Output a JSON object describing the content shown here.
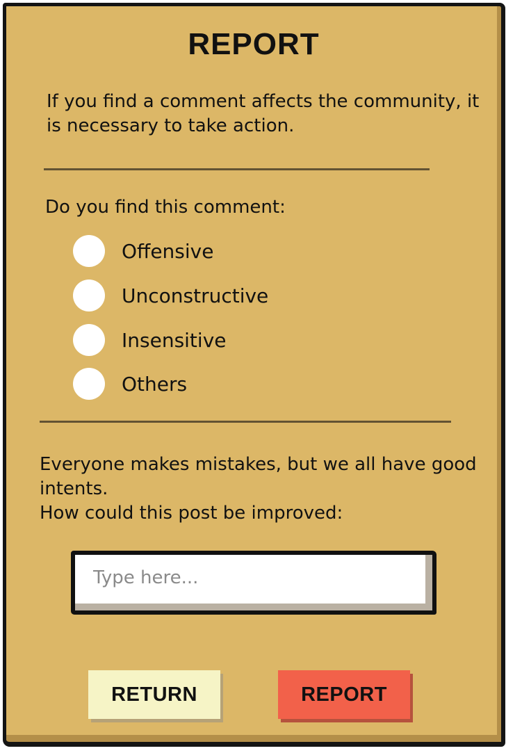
{
  "dialog": {
    "title": "REPORT",
    "intro": "If you find a comment affects the community, it is necessary to take action.",
    "question": "Do you find this comment:",
    "options": [
      {
        "label": "Offensive",
        "selected": false
      },
      {
        "label": "Unconstructive",
        "selected": false
      },
      {
        "label": "Insensitive",
        "selected": false
      },
      {
        "label": "Others",
        "selected": false
      }
    ],
    "prompt_line1": "Everyone makes mistakes, but we all have good intents.",
    "prompt_line2": "How could this post be improved:",
    "input": {
      "value": "",
      "placeholder": "Type here..."
    },
    "buttons": {
      "return_label": "RETURN",
      "report_label": "REPORT"
    }
  },
  "colors": {
    "panel": "#dcb767",
    "border": "#141414",
    "return_button": "#f6f4c6",
    "report_button": "#f2614a",
    "radio": "#ffffff"
  }
}
